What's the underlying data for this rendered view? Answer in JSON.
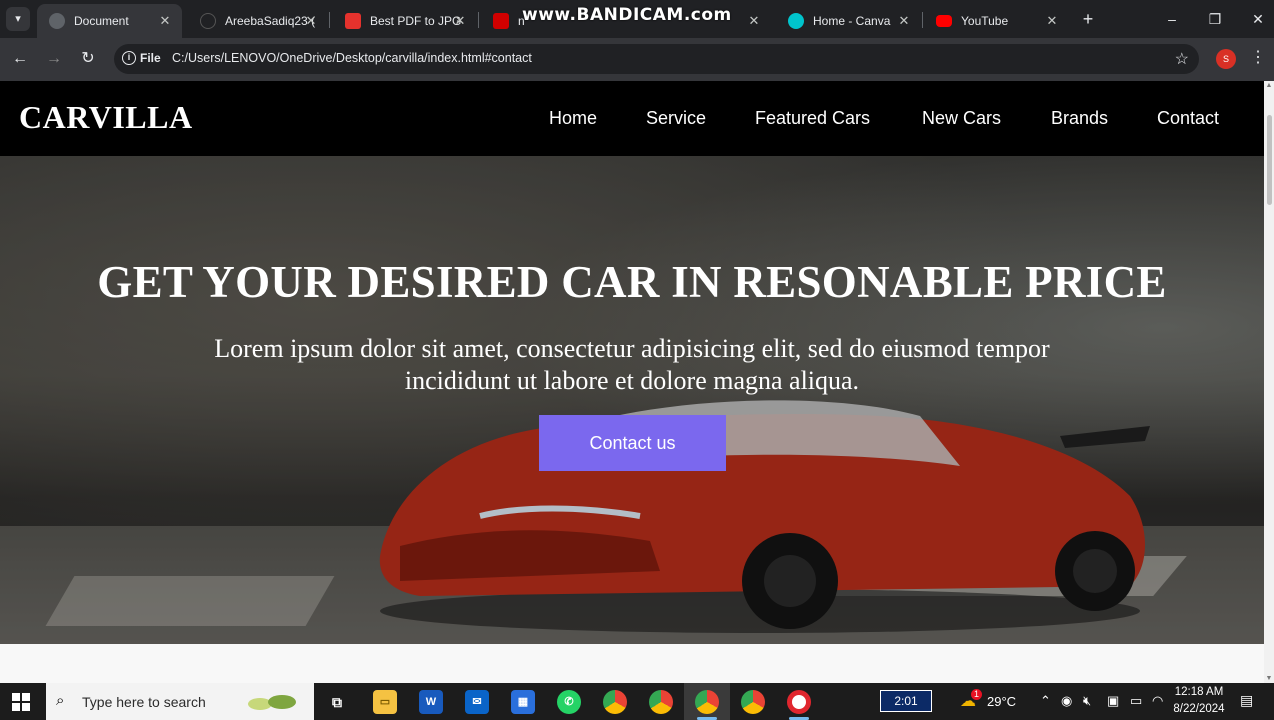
{
  "browser": {
    "tabs": [
      {
        "title": "Document",
        "favicon_color": "#5f6368",
        "active": true
      },
      {
        "title": "AreebaSadiq23 (",
        "favicon_color": "#202124",
        "active": false
      },
      {
        "title": "Best PDF to JPG",
        "favicon_color": "#e5322d",
        "active": false
      },
      {
        "title": "n",
        "favicon_color": "#d00000",
        "active": false
      },
      {
        "title": "Home - Canva",
        "favicon_color": "#00c4cc",
        "active": false
      },
      {
        "title": "YouTube",
        "favicon_color": "#ff0000",
        "active": false
      }
    ],
    "watermark": "www.BANDICAM.com",
    "address": {
      "scheme_label": "File",
      "url": "C:/Users/LENOVO/OneDrive/Desktop/carvilla/index.html#contact"
    },
    "profile_initial": "S"
  },
  "site": {
    "logo": "CARVILLA",
    "nav": [
      "Home",
      "Service",
      "Featured Cars",
      "New Cars",
      "Brands",
      "Contact"
    ],
    "hero": {
      "title": "GET YOUR DESIRED CAR IN RESONABLE PRICE",
      "text": "Lorem ipsum dolor sit amet, consectetur adipisicing elit, sed do eiusmod tempor incididunt ut labore et dolore magna aliqua.",
      "button": "Contact us",
      "accent": "#7b68ee"
    }
  },
  "taskbar": {
    "search_placeholder": "Type here to search",
    "recording_timer": "2:01",
    "temperature": "29°C",
    "time": "12:18 AM",
    "date": "8/22/2024",
    "weather_badge": "1"
  }
}
